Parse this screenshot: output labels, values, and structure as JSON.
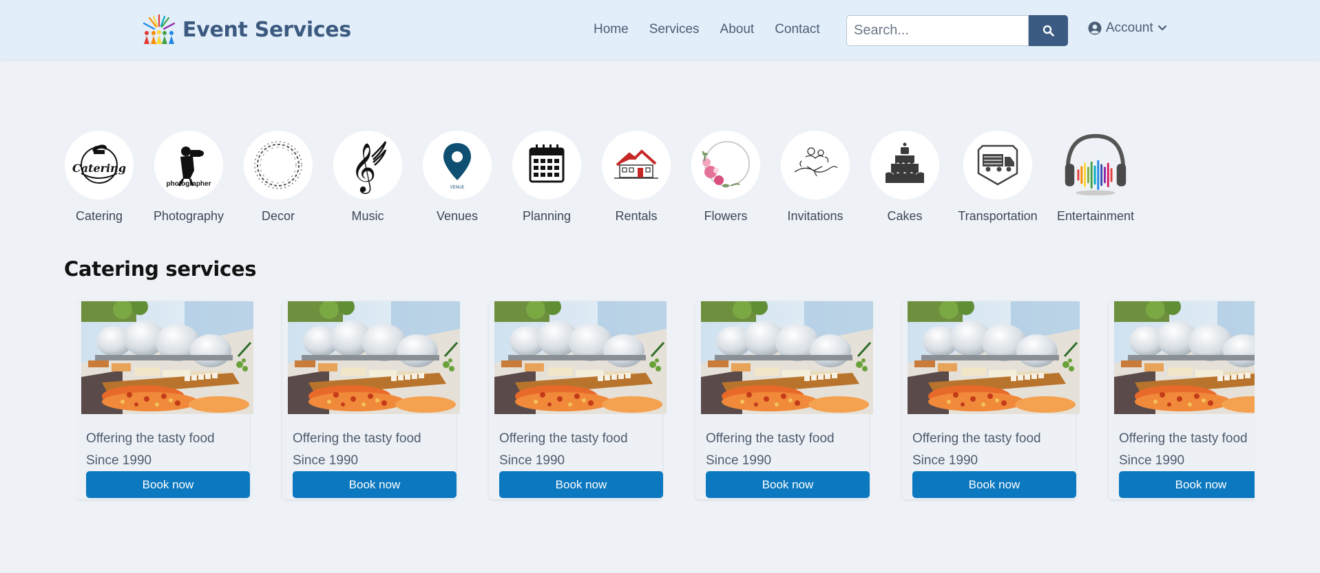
{
  "brand": {
    "name": "Event Services",
    "logo_icon": "people-celebration-logo-icon"
  },
  "nav": {
    "links": [
      "Home",
      "Services",
      "About",
      "Contact"
    ]
  },
  "search": {
    "placeholder": "Search...",
    "icon": "search-icon"
  },
  "account": {
    "label": "Account",
    "icon": "user-circle-icon",
    "caret": "chevron-down-icon"
  },
  "categories": [
    {
      "label": "Catering",
      "icon": "catering-icon"
    },
    {
      "label": "Photography",
      "icon": "photographer-icon"
    },
    {
      "label": "Decor",
      "icon": "wreath-icon"
    },
    {
      "label": "Music",
      "icon": "treble-clef-icon"
    },
    {
      "label": "Venues",
      "icon": "location-pin-icon"
    },
    {
      "label": "Planning",
      "icon": "calendar-icon"
    },
    {
      "label": "Rentals",
      "icon": "house-icon"
    },
    {
      "label": "Flowers",
      "icon": "floral-wreath-icon"
    },
    {
      "label": "Invitations",
      "icon": "invitation-sketch-icon"
    },
    {
      "label": "Cakes",
      "icon": "cake-icon"
    },
    {
      "label": "Transportation",
      "icon": "truck-icon"
    },
    {
      "label": "Entertainment",
      "icon": "headphones-icon"
    }
  ],
  "category_logo_text": {
    "catering": "Catering",
    "photography": "photographer",
    "venue": "VENUE"
  },
  "section": {
    "title": "Catering services"
  },
  "cards": [
    {
      "line1": "Offering the tasty food",
      "line2": "Since 1990",
      "button": "Book now"
    },
    {
      "line1": "Offering the tasty food",
      "line2": "Since 1990",
      "button": "Book now"
    },
    {
      "line1": "Offering the tasty food",
      "line2": "Since 1990",
      "button": "Book now"
    },
    {
      "line1": "Offering the tasty food",
      "line2": "Since 1990",
      "button": "Book now"
    },
    {
      "line1": "Offering the tasty food",
      "line2": "Since 1990",
      "button": "Book now"
    },
    {
      "line1": "Offering the tasty food",
      "line2": "Since 1990",
      "button": "Book now"
    }
  ],
  "colors": {
    "navbar_bg": "#e2eef9",
    "page_bg": "#eef2f7",
    "brand": "#3c5a80",
    "search_button": "#3b5b82",
    "book_button": "#0b78bf"
  }
}
